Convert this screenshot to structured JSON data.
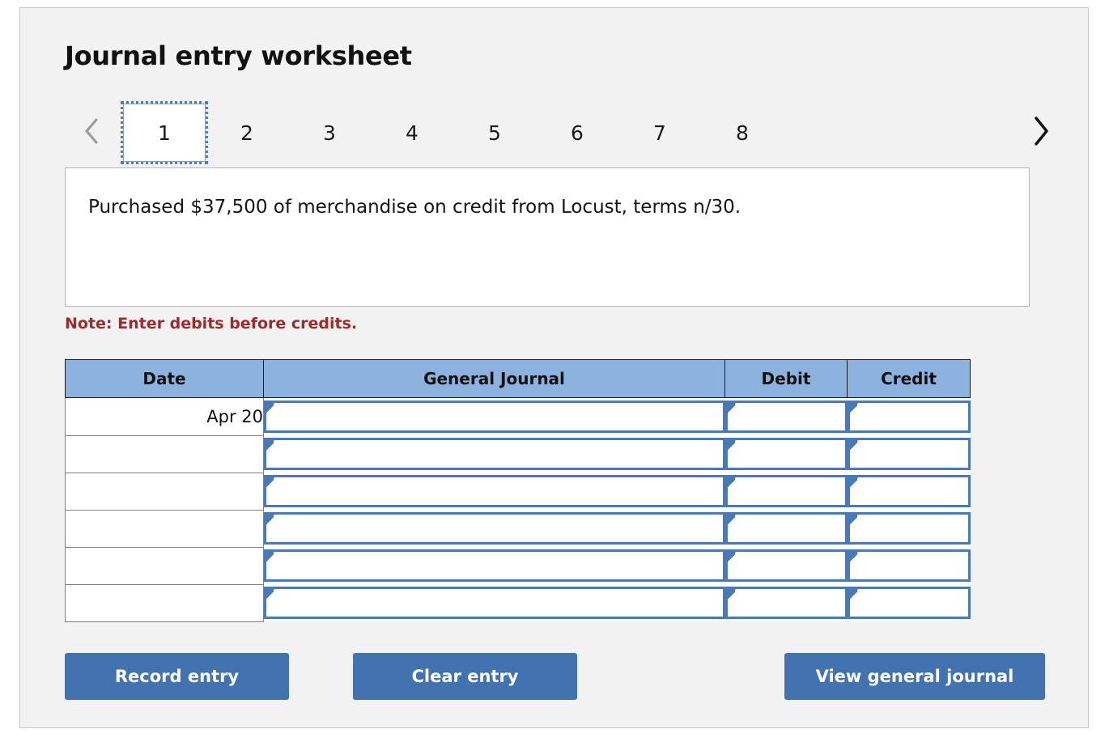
{
  "page_title": "Journal entry worksheet",
  "nav": {
    "prev_icon": "chevron-left-icon",
    "next_icon": "chevron-right-icon",
    "prev_enabled": false,
    "next_enabled": true,
    "prev_color": "#9a9a9a",
    "next_color": "#111111"
  },
  "tabs": [
    {
      "label": "1",
      "active": true
    },
    {
      "label": "2",
      "active": false
    },
    {
      "label": "3",
      "active": false
    },
    {
      "label": "4",
      "active": false
    },
    {
      "label": "5",
      "active": false
    },
    {
      "label": "6",
      "active": false
    },
    {
      "label": "7",
      "active": false
    },
    {
      "label": "8",
      "active": false
    }
  ],
  "description": "Purchased $37,500 of merchandise on credit from Locust, terms n/30.",
  "note": "Note: Enter debits before credits.",
  "table": {
    "headers": [
      "Date",
      "General Journal",
      "Debit",
      "Credit"
    ],
    "rows": [
      {
        "date": "Apr 20",
        "general_journal": "",
        "debit": "",
        "credit": ""
      },
      {
        "date": "",
        "general_journal": "",
        "debit": "",
        "credit": ""
      },
      {
        "date": "",
        "general_journal": "",
        "debit": "",
        "credit": ""
      },
      {
        "date": "",
        "general_journal": "",
        "debit": "",
        "credit": ""
      },
      {
        "date": "",
        "general_journal": "",
        "debit": "",
        "credit": ""
      },
      {
        "date": "",
        "general_journal": "",
        "debit": "",
        "credit": ""
      }
    ]
  },
  "buttons": {
    "record": "Record entry",
    "clear": "Clear entry",
    "view": "View general journal"
  },
  "colors": {
    "panel_bg": "#f2f2f2",
    "header_blue": "#8cb3e0",
    "input_border_blue": "#4a79b8",
    "button_blue": "#4272b0",
    "note_red": "#9e2a2b",
    "tab_focus_blue": "#4a7ebb"
  }
}
